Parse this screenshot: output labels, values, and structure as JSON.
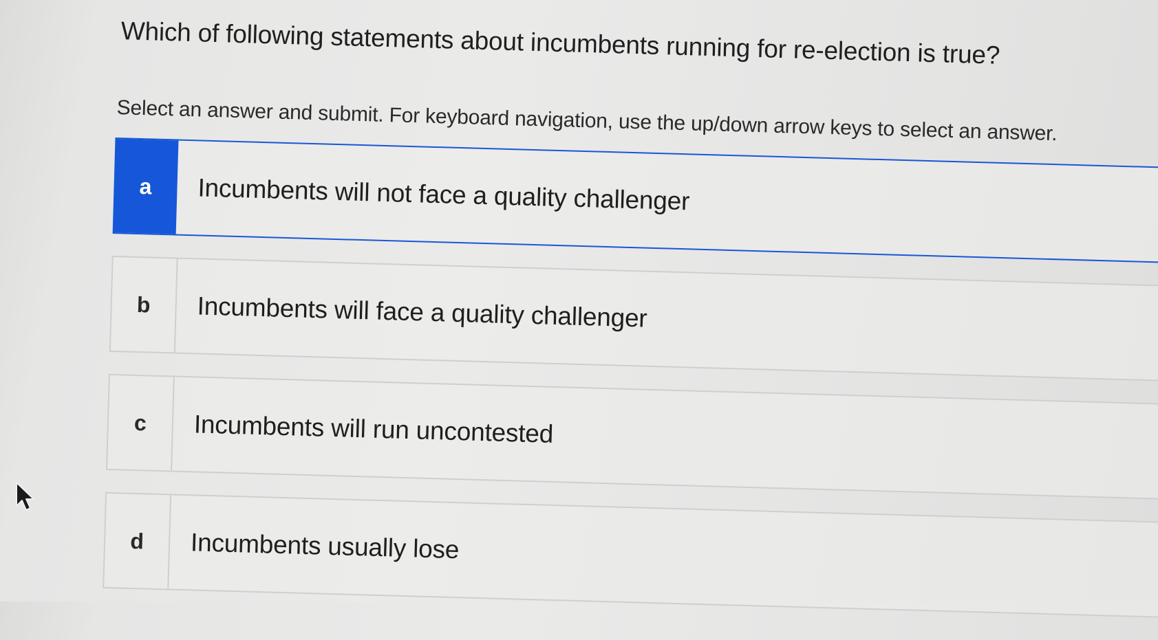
{
  "question": {
    "text": "Which of following statements about incumbents running for re-election is true?"
  },
  "instructions": {
    "text": "Select an answer and submit. For keyboard navigation, use the up/down arrow keys to select an answer."
  },
  "options": [
    {
      "letter": "a",
      "text": "Incumbents will not face a quality challenger",
      "selected": true
    },
    {
      "letter": "b",
      "text": "Incumbents will face a quality challenger",
      "selected": false
    },
    {
      "letter": "c",
      "text": "Incumbents will run uncontested",
      "selected": false
    },
    {
      "letter": "d",
      "text": "Incumbents usually lose",
      "selected": false
    }
  ],
  "colors": {
    "selected_accent": "#1557d8",
    "border": "#cfcfce"
  },
  "icons": {
    "cursor": "mouse-pointer-icon"
  }
}
